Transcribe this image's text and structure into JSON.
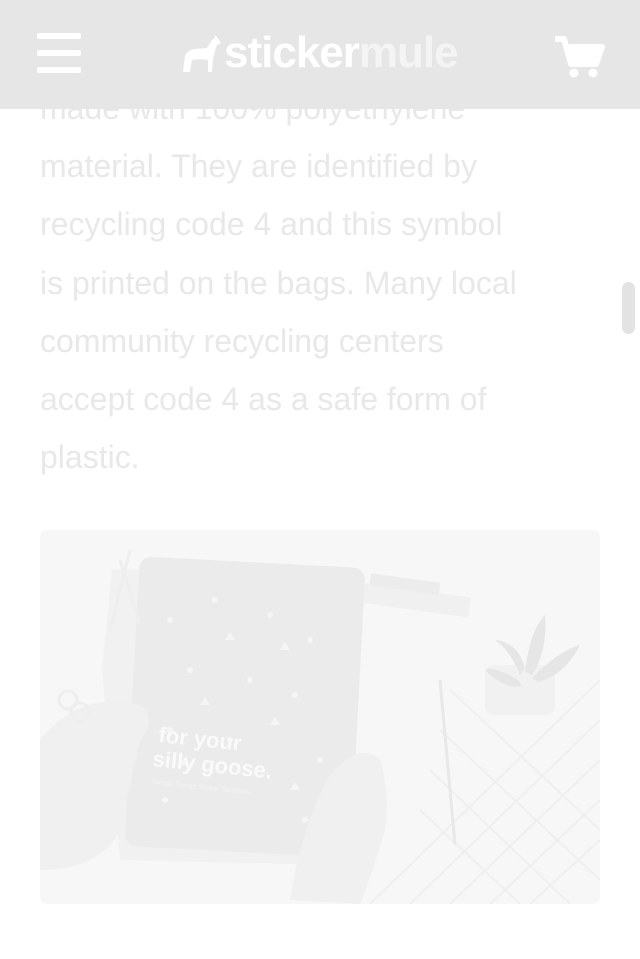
{
  "header": {
    "menu_icon": "hamburger-menu-icon",
    "logo": {
      "part1": "sticker",
      "part2": "mule"
    },
    "cart_icon": "shopping-cart-icon"
  },
  "article": {
    "paragraph_lines": [
      "made with 100% polyethylene",
      "material. They are identified by",
      "recycling code 4 and this symbol",
      "is printed on the bags. Many local",
      "community recycling centers",
      "accept code 4 as a safe form of",
      "plastic."
    ]
  },
  "figure": {
    "package_headline_1": "for your",
    "package_headline_2": "silly goose.",
    "package_subtitle": "Simple Things Sticker Sessions"
  },
  "colors": {
    "header_bg": "#e6e6e6",
    "text": "#e8e8e8",
    "image_bg": "#f7f7f7"
  }
}
